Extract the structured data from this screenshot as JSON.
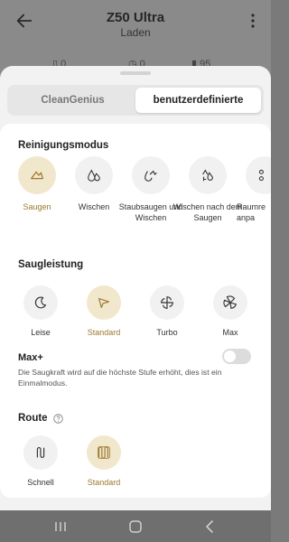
{
  "header": {
    "title": "Z50 Ultra",
    "subtitle": "Laden"
  },
  "stats": [
    "0",
    "0",
    "95"
  ],
  "tabs": {
    "left": "CleanGenius",
    "right": "benutzerdefinierte"
  },
  "cleaning_mode": {
    "title": "Reinigungsmodus",
    "options": [
      {
        "label": "Saugen",
        "icon": "vacuum-icon",
        "selected": true
      },
      {
        "label": "Wischen",
        "icon": "mop-drop-icon",
        "selected": false
      },
      {
        "label": "Staubsaugen und Wischen",
        "icon": "vacuum-mop-icon",
        "selected": false
      },
      {
        "label": "Wischen nach dem Saugen",
        "icon": "mop-after-vacuum-icon",
        "selected": false
      },
      {
        "label": "Raumre anpa",
        "icon": "room-custom-icon",
        "selected": false
      }
    ]
  },
  "suction": {
    "title": "Saugleistung",
    "options": [
      {
        "label": "Leise",
        "icon": "quiet-icon",
        "selected": false
      },
      {
        "label": "Standard",
        "icon": "standard-icon",
        "selected": true
      },
      {
        "label": "Turbo",
        "icon": "turbo-icon",
        "selected": false
      },
      {
        "label": "Max",
        "icon": "max-icon",
        "selected": false
      }
    ]
  },
  "maxplus": {
    "title": "Max+",
    "description": "Die Saugkraft wird auf die höchste Stufe erhöht, dies ist ein Einmalmodus.",
    "enabled": false
  },
  "route": {
    "title": "Route",
    "options": [
      {
        "label": "Schnell",
        "icon": "fast-route-icon",
        "selected": false
      },
      {
        "label": "Standard",
        "icon": "standard-route-icon",
        "selected": true
      }
    ]
  },
  "colors": {
    "accent": "#9b7a2e",
    "selected_bg": "#f1e7cc"
  }
}
